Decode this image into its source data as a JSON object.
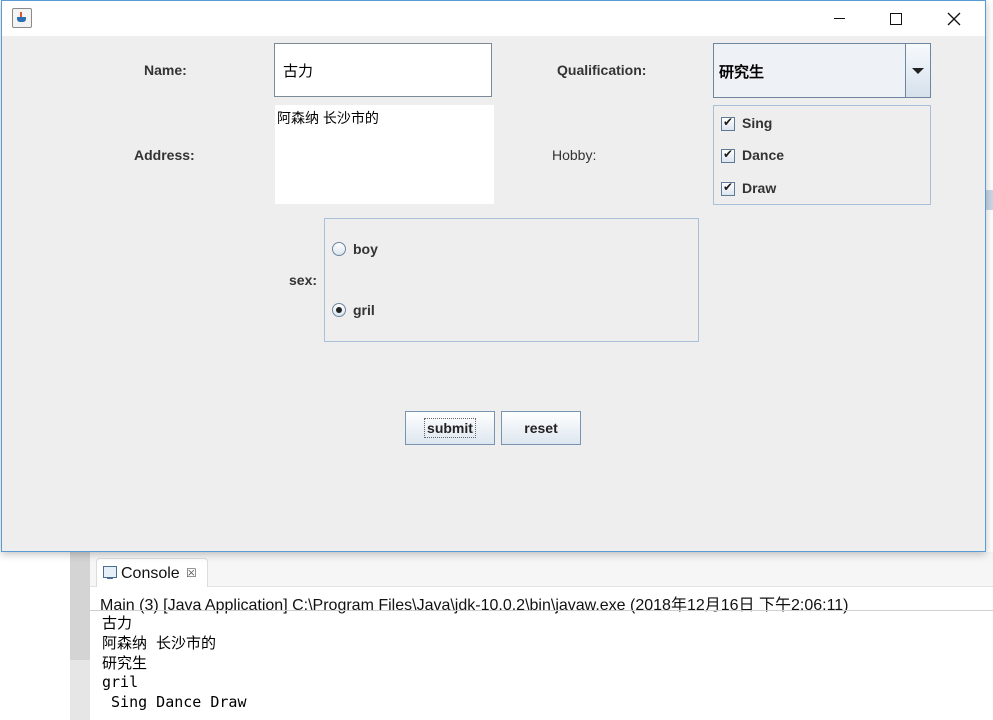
{
  "console": {
    "tab_label": "Console",
    "tab_close": "☒",
    "header": "Main (3) [Java Application] C:\\Program Files\\Java\\jdk-10.0.2\\bin\\javaw.exe (2018年12月16日 下午2:06:11)",
    "lines": [
      "古力",
      "阿森纳 长沙市的",
      "研究生",
      "gril",
      " Sing Dance Draw"
    ]
  },
  "form": {
    "name_label": "Name:",
    "name_value": "古力",
    "address_label": "Address:",
    "address_value": "阿森纳 长沙市的",
    "qualification_label": "Qualification:",
    "qualification_value": "研究生",
    "hobby_label": "Hobby:",
    "hobbies": [
      {
        "label": "Sing",
        "checked": true
      },
      {
        "label": "Dance",
        "checked": true
      },
      {
        "label": "Draw",
        "checked": true
      }
    ],
    "sex_label": "sex:",
    "sex_options": [
      {
        "label": "boy",
        "selected": false
      },
      {
        "label": "gril",
        "selected": true
      }
    ],
    "submit_label": "submit",
    "reset_label": "reset"
  },
  "icons": [
    "java-app-icon",
    "minimize-icon",
    "maximize-icon",
    "close-icon",
    "console-icon"
  ]
}
